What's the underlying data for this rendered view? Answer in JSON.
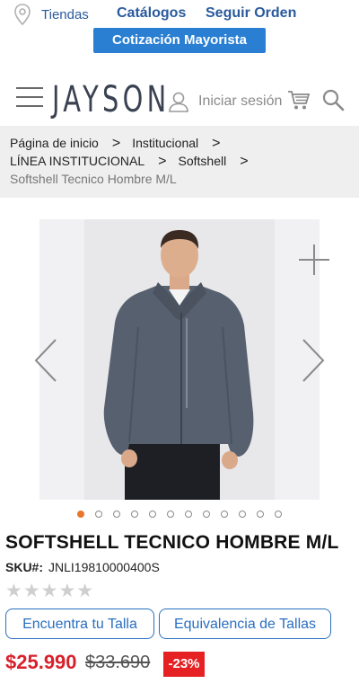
{
  "topbar": {
    "stores_label": "Tiendas",
    "catalogs_label": "Catálogos",
    "track_order_label": "Seguir Orden",
    "wholesale_label": "Cotización Mayorista"
  },
  "header": {
    "logo_text": "JAYSON",
    "login_label": "Iniciar sesión"
  },
  "breadcrumb": {
    "items": [
      "Página de inicio",
      "Institucional",
      "LÍNEA INSTITUCIONAL",
      "Softshell"
    ],
    "current": "Softshell Tecnico Hombre M/L",
    "separator": ">"
  },
  "gallery": {
    "total_images": 12,
    "active_index": 0
  },
  "product": {
    "title": "SOFTSHELL TECNICO HOMBRE M/L",
    "sku_label": "SKU#:",
    "sku_value": "JNLI19810000400S",
    "rating_stars": "★★★★★",
    "rating_value": 0,
    "find_size_label": "Encuentra tu Talla",
    "size_equivalence_label": "Equivalencia de Tallas",
    "price": "$25.990",
    "old_price": "$33.690",
    "discount": "-23%"
  },
  "colors": {
    "brand_blue": "#2a5a9c",
    "button_blue": "#2a7fd3",
    "price_red": "#d8202b",
    "discount_red": "#e52124",
    "active_dot": "#e8762c"
  },
  "icons": [
    "location-pin-icon",
    "hamburger-menu-icon",
    "user-icon",
    "cart-icon",
    "search-icon",
    "zoom-plus-icon",
    "chevron-left-icon",
    "chevron-right-icon"
  ]
}
